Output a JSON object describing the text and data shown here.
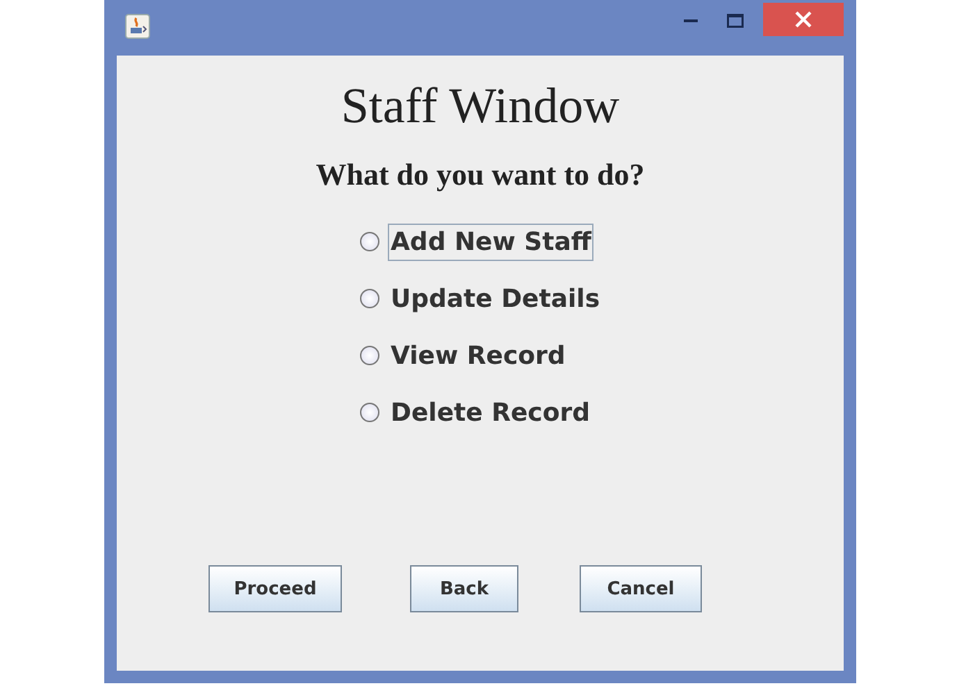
{
  "window": {
    "title": "Staff Window"
  },
  "prompt": "What do you want to do?",
  "options": [
    {
      "label": "Add New Staff",
      "selected": false,
      "focused": true
    },
    {
      "label": "Update Details",
      "selected": false,
      "focused": false
    },
    {
      "label": "View Record",
      "selected": false,
      "focused": false
    },
    {
      "label": "Delete Record",
      "selected": false,
      "focused": false
    }
  ],
  "buttons": [
    "Proceed",
    "Back",
    "Cancel"
  ]
}
